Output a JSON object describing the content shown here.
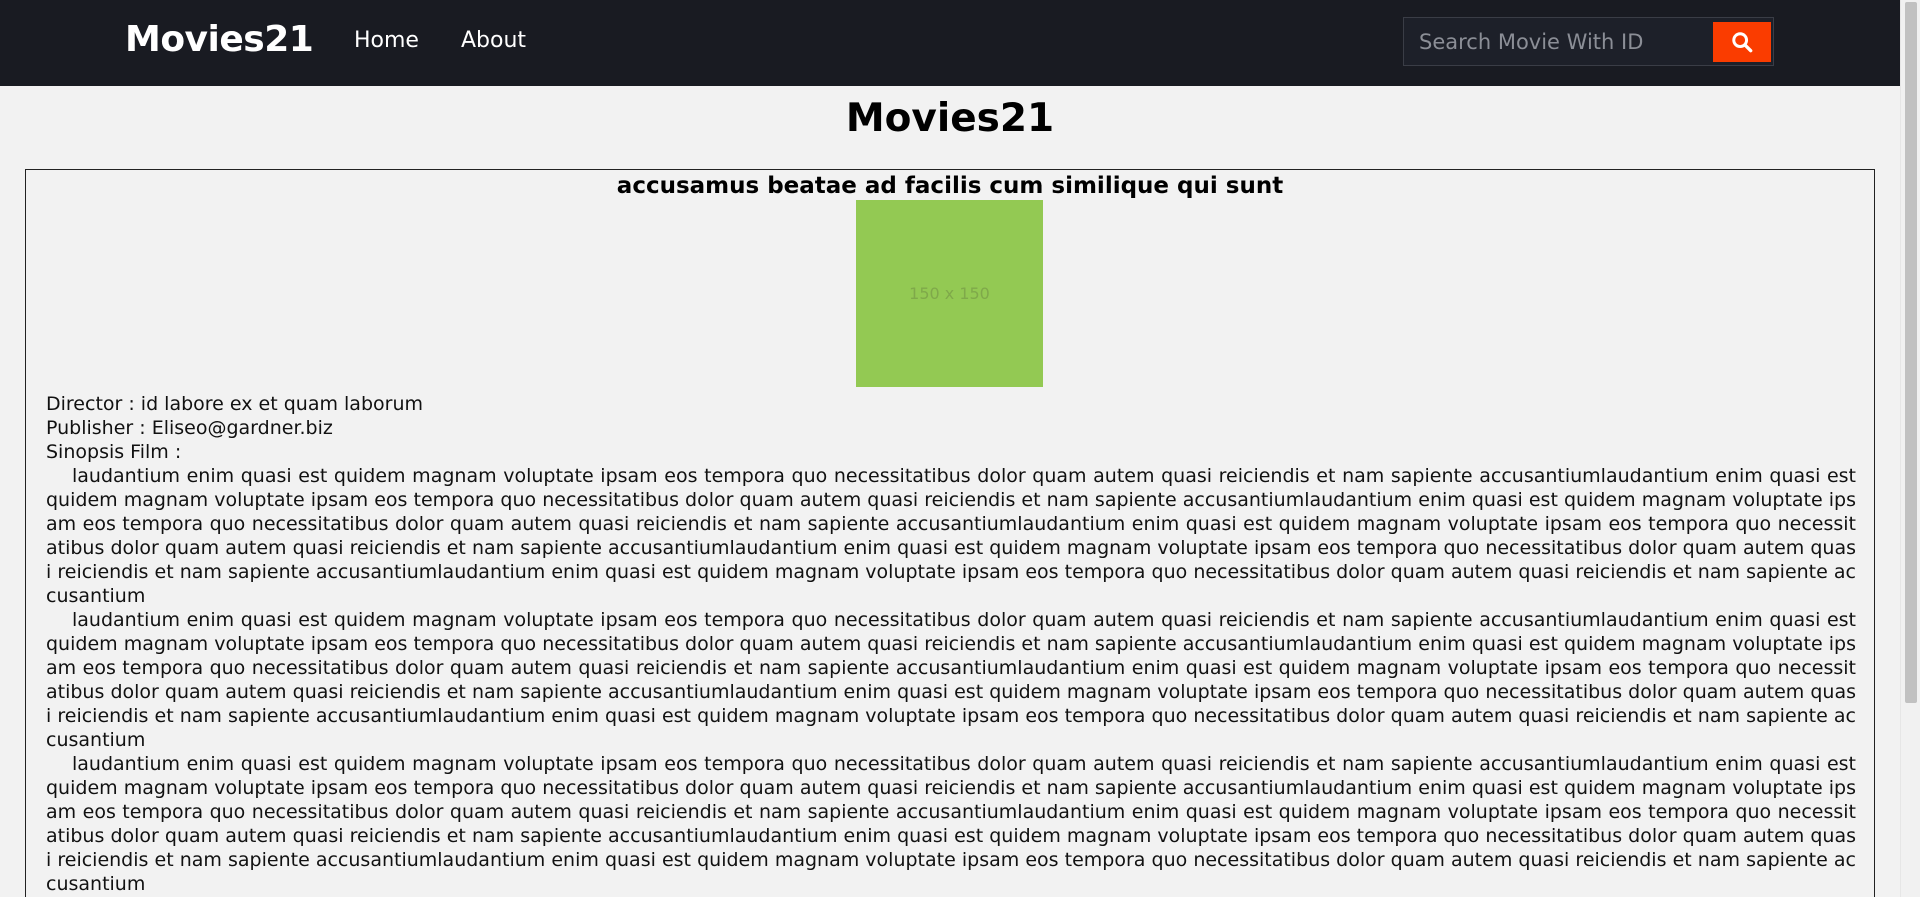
{
  "navbar": {
    "brand": "Movies21",
    "links": [
      "Home",
      "About"
    ],
    "search_placeholder": "Search Movie With ID",
    "search_icon": "search-icon"
  },
  "page": {
    "title": "Movies21"
  },
  "movie": {
    "title": "accusamus beatae ad facilis cum similique qui sunt",
    "poster_label": "150 x 150",
    "director": "Director : id labore ex et quam laborum",
    "publisher": "Publisher : Eliseo@gardner.biz",
    "synopsis_label": "Sinopsis Film :",
    "synopsis": [
      "laudantium enim quasi est quidem magnam voluptate ipsam eos tempora quo necessitatibus dolor quam autem quasi reiciendis et nam sapiente accusantiumlaudantium enim quasi est quidem magnam voluptate ipsam eos tempora quo necessitatibus dolor quam autem quasi reiciendis et nam sapiente accusantiumlaudantium enim quasi est quidem magnam voluptate ipsam eos tempora quo necessitatibus dolor quam autem quasi reiciendis et nam sapiente accusantiumlaudantium enim quasi est quidem magnam voluptate ipsam eos tempora quo necessitatibus dolor quam autem quasi reiciendis et nam sapiente accusantiumlaudantium enim quasi est quidem magnam voluptate ipsam eos tempora quo necessitatibus dolor quam autem quasi reiciendis et nam sapiente accusantiumlaudantium enim quasi est quidem magnam voluptate ipsam eos tempora quo necessitatibus dolor quam autem quasi reiciendis et nam sapiente accusantium",
      "laudantium enim quasi est quidem magnam voluptate ipsam eos tempora quo necessitatibus dolor quam autem quasi reiciendis et nam sapiente accusantiumlaudantium enim quasi est quidem magnam voluptate ipsam eos tempora quo necessitatibus dolor quam autem quasi reiciendis et nam sapiente accusantiumlaudantium enim quasi est quidem magnam voluptate ipsam eos tempora quo necessitatibus dolor quam autem quasi reiciendis et nam sapiente accusantiumlaudantium enim quasi est quidem magnam voluptate ipsam eos tempora quo necessitatibus dolor quam autem quasi reiciendis et nam sapiente accusantiumlaudantium enim quasi est quidem magnam voluptate ipsam eos tempora quo necessitatibus dolor quam autem quasi reiciendis et nam sapiente accusantiumlaudantium enim quasi est quidem magnam voluptate ipsam eos tempora quo necessitatibus dolor quam autem quasi reiciendis et nam sapiente accusantium",
      "laudantium enim quasi est quidem magnam voluptate ipsam eos tempora quo necessitatibus dolor quam autem quasi reiciendis et nam sapiente accusantiumlaudantium enim quasi est quidem magnam voluptate ipsam eos tempora quo necessitatibus dolor quam autem quasi reiciendis et nam sapiente accusantiumlaudantium enim quasi est quidem magnam voluptate ipsam eos tempora quo necessitatibus dolor quam autem quasi reiciendis et nam sapiente accusantiumlaudantium enim quasi est quidem magnam voluptate ipsam eos tempora quo necessitatibus dolor quam autem quasi reiciendis et nam sapiente accusantiumlaudantium enim quasi est quidem magnam voluptate ipsam eos tempora quo necessitatibus dolor quam autem quasi reiciendis et nam sapiente accusantiumlaudantium enim quasi est quidem magnam voluptate ipsam eos tempora quo necessitatibus dolor quam autem quasi reiciendis et nam sapiente accusantium"
    ]
  },
  "colors": {
    "navbar_bg": "#191b22",
    "accent": "#fa3c00",
    "poster_bg": "#93c953",
    "page_bg": "#f2f2f2"
  }
}
